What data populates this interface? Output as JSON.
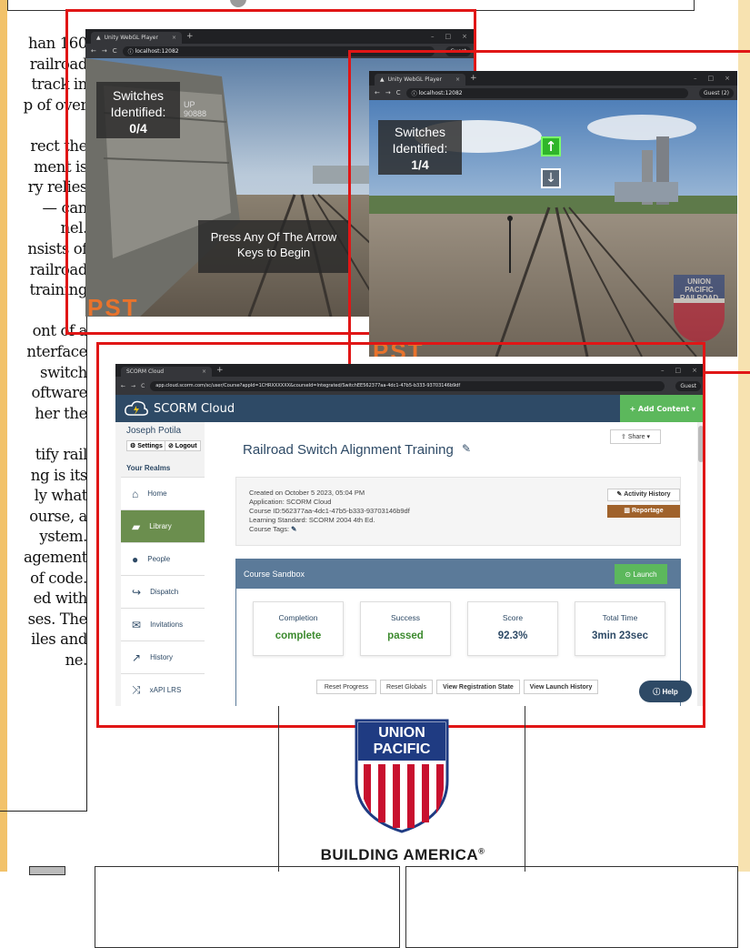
{
  "document_fragments": [
    "han 160",
    "railroad",
    "track in",
    "p of over",
    "",
    "rect the",
    "ment is",
    "ry relies",
    "— can",
    "nel.",
    "nsists of",
    "railroad",
    "training",
    "",
    "ont of a",
    "nterface",
    "switch",
    "oftware",
    "her the",
    "",
    "tify rail",
    "ng is its",
    "ly what",
    "ourse, a",
    "ystem.",
    "agement",
    "of code.",
    "ed with",
    "ses. The",
    "iles and",
    "ne."
  ],
  "shot1": {
    "tab_title": "Unity WebGL Player",
    "url": "localhost:12082",
    "guest": "Guest",
    "hud_title": "Switches Identified:",
    "hud_count": "0/4",
    "prompt": "Press Any Of The Arrow Keys to Begin",
    "car_mark": "UP",
    "car_number": "90888",
    "pst_logo": "PST"
  },
  "shot2": {
    "tab_title": "Unity WebGL Player",
    "url": "localhost:12082",
    "guest": "Guest (2)",
    "hud_title": "Switches Identified:",
    "hud_count": "1/4",
    "watermark_line1": "UNION",
    "watermark_line2": "PACIFIC",
    "watermark_line3": "RAILROAD",
    "pst_logo": "PST"
  },
  "shot3": {
    "tab_title": "SCORM Cloud",
    "url": "app.cloud.scorm.com/sc/user/Course?appId=1CHRXXXXXX&courseId=Integrated/SwitchEE562377aa-4dc1-47b5-b333-93703146b9df",
    "guest": "Guest",
    "logo_text": "SCORM Cloud",
    "add_content": "+ Add Content",
    "user_name": "Joseph Potila",
    "settings": "⚙ Settings",
    "logout": "⊘ Logout",
    "your_realms": "Your Realms",
    "nav": [
      {
        "label": "Home",
        "icon": "⌂"
      },
      {
        "label": "Library",
        "icon": "▰"
      },
      {
        "label": "People",
        "icon": "●"
      },
      {
        "label": "Dispatch",
        "icon": "↪"
      },
      {
        "label": "Invitations",
        "icon": "✉"
      },
      {
        "label": "History",
        "icon": "↗"
      },
      {
        "label": "xAPI LRS",
        "icon": "⤨"
      }
    ],
    "share": "Share",
    "course_title": "Railroad Switch Alignment Training",
    "created": "Created on October 5 2023, 05:04 PM",
    "application": "Application: SCORM Cloud",
    "course_id": "Course ID:562377aa-4dc1-47b5-b333-93703146b9df",
    "standard": "Learning Standard: SCORM 2004 4th Ed.",
    "tags": "Course Tags:",
    "activity_history": "Activity History",
    "reportage": "Reportage",
    "sandbox": "Course Sandbox",
    "launch": "Launch",
    "stats": [
      {
        "label": "Completion",
        "value": "complete"
      },
      {
        "label": "Success",
        "value": "passed"
      },
      {
        "label": "Score",
        "value": "92.3%"
      },
      {
        "label": "Total Time",
        "value": "3min 23sec"
      }
    ],
    "buttons": [
      "Reset Progress",
      "Reset Globals",
      "View Registration State",
      "View Launch History"
    ],
    "help": "Help"
  },
  "logo": {
    "line1": "UNION",
    "line2": "PACIFIC",
    "tagline": "BUILDING AMERICA",
    "reg": "®"
  },
  "colors": {
    "red_box": "#e01616",
    "scorm_header": "#2e4a66",
    "success_green": "#3c8a2e",
    "up_blue": "#1f3b82",
    "up_red": "#c8102e"
  }
}
